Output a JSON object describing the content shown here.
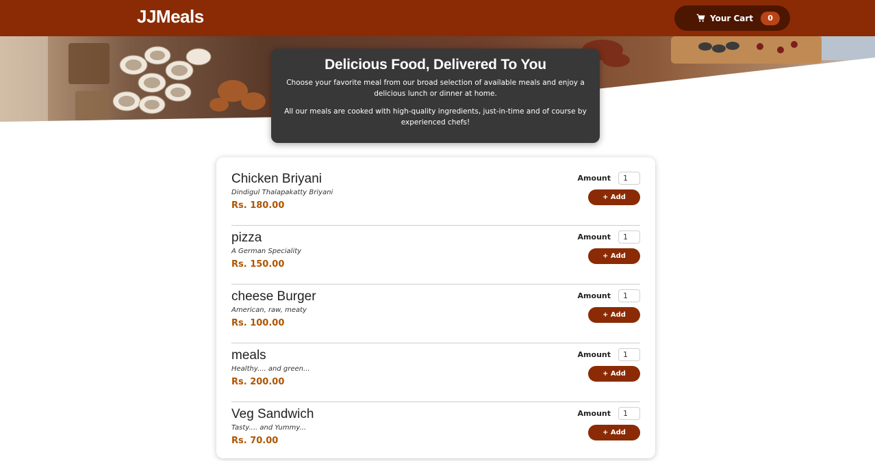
{
  "header": {
    "brand": "JJMeals",
    "cart_label": "Your Cart",
    "cart_count": "0",
    "cart_icon": "shopping-cart-icon"
  },
  "colors": {
    "header_bg": "#8a2b06",
    "cart_button_bg": "#4d1601",
    "badge_bg": "#b94517",
    "summary_bg": "#383838",
    "price": "#ad5502",
    "add_button_bg": "#8a2b06"
  },
  "summary": {
    "title": "Delicious Food, Delivered To You",
    "paragraph1": "Choose your favorite meal from our broad selection of available meals and enjoy a delicious lunch or dinner at home.",
    "paragraph2": "All our meals are cooked with high-quality ingredients, just-in-time and of course by experienced chefs!"
  },
  "meals": [
    {
      "name": "Chicken Briyani",
      "description": "Dindigul Thalapakatty Briyani",
      "price": "Rs. 180.00",
      "amount_label": "Amount",
      "amount_value": "1",
      "add_label": "+ Add"
    },
    {
      "name": "pizza",
      "description": "A German Speciality",
      "price": "Rs. 150.00",
      "amount_label": "Amount",
      "amount_value": "1",
      "add_label": "+ Add"
    },
    {
      "name": "cheese Burger",
      "description": "American, raw, meaty",
      "price": "Rs. 100.00",
      "amount_label": "Amount",
      "amount_value": "1",
      "add_label": "+ Add"
    },
    {
      "name": "meals",
      "description": "Healthy.... and green...",
      "price": "Rs. 200.00",
      "amount_label": "Amount",
      "amount_value": "1",
      "add_label": "+ Add"
    },
    {
      "name": "Veg Sandwich",
      "description": "Tasty.... and Yummy...",
      "price": "Rs. 70.00",
      "amount_label": "Amount",
      "amount_value": "1",
      "add_label": "+ Add"
    }
  ]
}
